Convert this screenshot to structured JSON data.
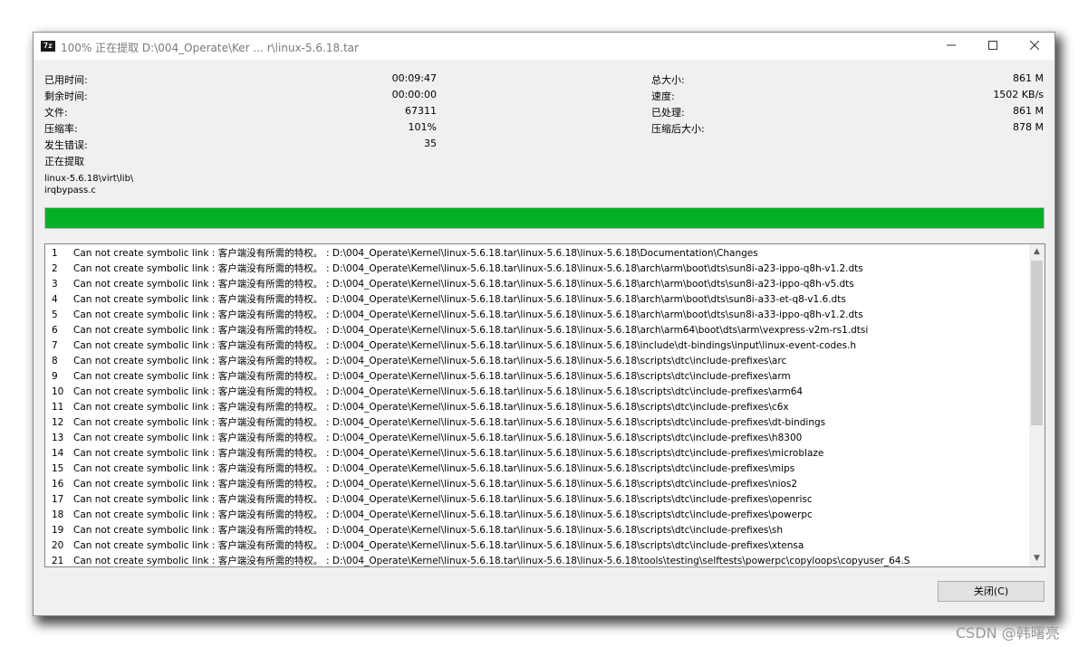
{
  "window": {
    "icon_text": "7z",
    "title": "100% 正在提取 D:\\004_Operate\\Ker ... r\\linux-5.6.18.tar"
  },
  "stats_left": [
    {
      "label": "已用时间:",
      "value": "00:09:47"
    },
    {
      "label": "剩余时间:",
      "value": "00:00:00"
    },
    {
      "label": "文件:",
      "value": "67311"
    },
    {
      "label": "压缩率:",
      "value": "101%"
    },
    {
      "label": "发生错误:",
      "value": "35"
    }
  ],
  "stats_right": [
    {
      "label": "总大小:",
      "value": "861 M"
    },
    {
      "label": "速度:",
      "value": "1502 KB/s"
    },
    {
      "label": "已处理:",
      "value": "861 M"
    },
    {
      "label": "压缩后大小:",
      "value": "878 M"
    }
  ],
  "current": {
    "label": "正在提取",
    "path_line1": "linux-5.6.18\\virt\\lib\\",
    "path_line2": "irqbypass.c"
  },
  "progress": {
    "percent": 100,
    "color": "#06b025"
  },
  "log": {
    "rows": [
      {
        "num": "1",
        "msg": "Can not create symbolic link : 客户端没有所需的特权。",
        "path": ": D:\\004_Operate\\Kernel\\linux-5.6.18.tar\\linux-5.6.18\\linux-5.6.18\\Documentation\\Changes"
      },
      {
        "num": "2",
        "msg": "Can not create symbolic link : 客户端没有所需的特权。",
        "path": ": D:\\004_Operate\\Kernel\\linux-5.6.18.tar\\linux-5.6.18\\linux-5.6.18\\arch\\arm\\boot\\dts\\sun8i-a23-ippo-q8h-v1.2.dts"
      },
      {
        "num": "3",
        "msg": "Can not create symbolic link : 客户端没有所需的特权。",
        "path": ": D:\\004_Operate\\Kernel\\linux-5.6.18.tar\\linux-5.6.18\\linux-5.6.18\\arch\\arm\\boot\\dts\\sun8i-a23-ippo-q8h-v5.dts"
      },
      {
        "num": "4",
        "msg": "Can not create symbolic link : 客户端没有所需的特权。",
        "path": ": D:\\004_Operate\\Kernel\\linux-5.6.18.tar\\linux-5.6.18\\linux-5.6.18\\arch\\arm\\boot\\dts\\sun8i-a33-et-q8-v1.6.dts"
      },
      {
        "num": "5",
        "msg": "Can not create symbolic link : 客户端没有所需的特权。",
        "path": ": D:\\004_Operate\\Kernel\\linux-5.6.18.tar\\linux-5.6.18\\linux-5.6.18\\arch\\arm\\boot\\dts\\sun8i-a33-ippo-q8h-v1.2.dts"
      },
      {
        "num": "6",
        "msg": "Can not create symbolic link : 客户端没有所需的特权。",
        "path": ": D:\\004_Operate\\Kernel\\linux-5.6.18.tar\\linux-5.6.18\\linux-5.6.18\\arch\\arm64\\boot\\dts\\arm\\vexpress-v2m-rs1.dtsi"
      },
      {
        "num": "7",
        "msg": "Can not create symbolic link : 客户端没有所需的特权。",
        "path": ": D:\\004_Operate\\Kernel\\linux-5.6.18.tar\\linux-5.6.18\\linux-5.6.18\\include\\dt-bindings\\input\\linux-event-codes.h"
      },
      {
        "num": "8",
        "msg": "Can not create symbolic link : 客户端没有所需的特权。",
        "path": ": D:\\004_Operate\\Kernel\\linux-5.6.18.tar\\linux-5.6.18\\linux-5.6.18\\scripts\\dtc\\include-prefixes\\arc"
      },
      {
        "num": "9",
        "msg": "Can not create symbolic link : 客户端没有所需的特权。",
        "path": ": D:\\004_Operate\\Kernel\\linux-5.6.18.tar\\linux-5.6.18\\linux-5.6.18\\scripts\\dtc\\include-prefixes\\arm"
      },
      {
        "num": "10",
        "msg": "Can not create symbolic link : 客户端没有所需的特权。",
        "path": ": D:\\004_Operate\\Kernel\\linux-5.6.18.tar\\linux-5.6.18\\linux-5.6.18\\scripts\\dtc\\include-prefixes\\arm64"
      },
      {
        "num": "11",
        "msg": "Can not create symbolic link : 客户端没有所需的特权。",
        "path": ": D:\\004_Operate\\Kernel\\linux-5.6.18.tar\\linux-5.6.18\\linux-5.6.18\\scripts\\dtc\\include-prefixes\\c6x"
      },
      {
        "num": "12",
        "msg": "Can not create symbolic link : 客户端没有所需的特权。",
        "path": ": D:\\004_Operate\\Kernel\\linux-5.6.18.tar\\linux-5.6.18\\linux-5.6.18\\scripts\\dtc\\include-prefixes\\dt-bindings"
      },
      {
        "num": "13",
        "msg": "Can not create symbolic link : 客户端没有所需的特权。",
        "path": ": D:\\004_Operate\\Kernel\\linux-5.6.18.tar\\linux-5.6.18\\linux-5.6.18\\scripts\\dtc\\include-prefixes\\h8300"
      },
      {
        "num": "14",
        "msg": "Can not create symbolic link : 客户端没有所需的特权。",
        "path": ": D:\\004_Operate\\Kernel\\linux-5.6.18.tar\\linux-5.6.18\\linux-5.6.18\\scripts\\dtc\\include-prefixes\\microblaze"
      },
      {
        "num": "15",
        "msg": "Can not create symbolic link : 客户端没有所需的特权。",
        "path": ": D:\\004_Operate\\Kernel\\linux-5.6.18.tar\\linux-5.6.18\\linux-5.6.18\\scripts\\dtc\\include-prefixes\\mips"
      },
      {
        "num": "16",
        "msg": "Can not create symbolic link : 客户端没有所需的特权。",
        "path": ": D:\\004_Operate\\Kernel\\linux-5.6.18.tar\\linux-5.6.18\\linux-5.6.18\\scripts\\dtc\\include-prefixes\\nios2"
      },
      {
        "num": "17",
        "msg": "Can not create symbolic link : 客户端没有所需的特权。",
        "path": ": D:\\004_Operate\\Kernel\\linux-5.6.18.tar\\linux-5.6.18\\linux-5.6.18\\scripts\\dtc\\include-prefixes\\openrisc"
      },
      {
        "num": "18",
        "msg": "Can not create symbolic link : 客户端没有所需的特权。",
        "path": ": D:\\004_Operate\\Kernel\\linux-5.6.18.tar\\linux-5.6.18\\linux-5.6.18\\scripts\\dtc\\include-prefixes\\powerpc"
      },
      {
        "num": "19",
        "msg": "Can not create symbolic link : 客户端没有所需的特权。",
        "path": ": D:\\004_Operate\\Kernel\\linux-5.6.18.tar\\linux-5.6.18\\linux-5.6.18\\scripts\\dtc\\include-prefixes\\sh"
      },
      {
        "num": "20",
        "msg": "Can not create symbolic link : 客户端没有所需的特权。",
        "path": ": D:\\004_Operate\\Kernel\\linux-5.6.18.tar\\linux-5.6.18\\linux-5.6.18\\scripts\\dtc\\include-prefixes\\xtensa"
      },
      {
        "num": "21",
        "msg": "Can not create symbolic link : 客户端没有所需的特权。",
        "path": ": D:\\004_Operate\\Kernel\\linux-5.6.18.tar\\linux-5.6.18\\linux-5.6.18\\tools\\testing\\selftests\\powerpc\\copyloops\\copyuser_64.S"
      }
    ]
  },
  "buttons": {
    "close_label": "关闭(C)"
  },
  "watermark": "CSDN @韩曙亮"
}
